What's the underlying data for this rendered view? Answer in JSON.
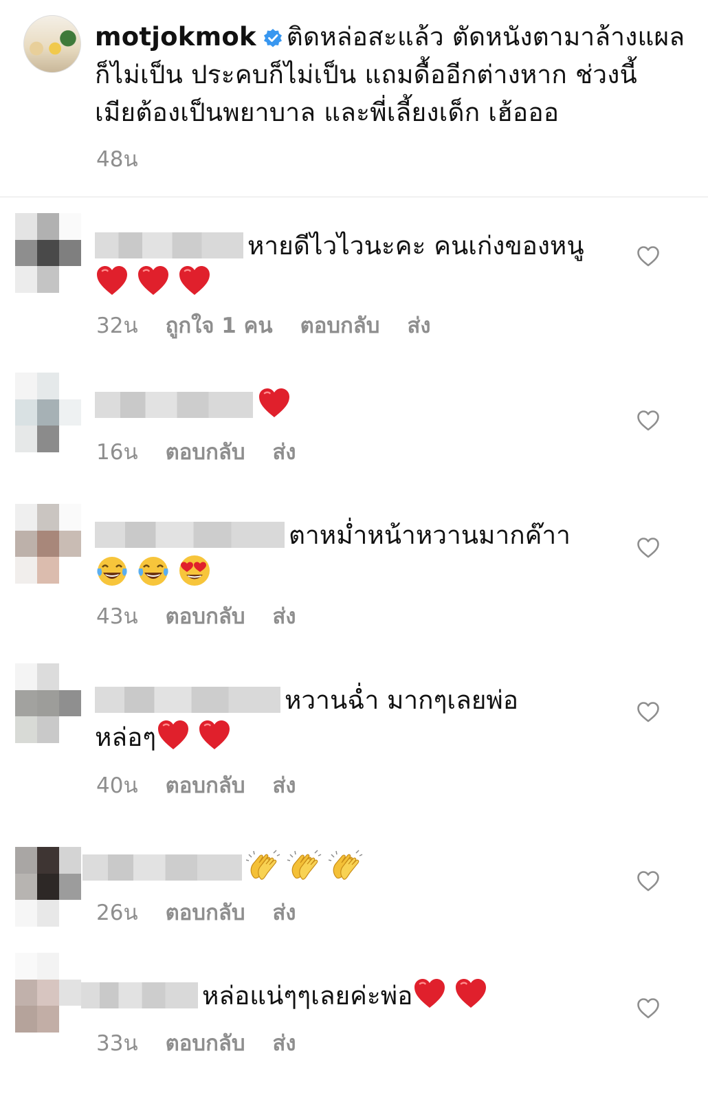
{
  "post": {
    "username": "motjokmok",
    "caption": "ติดหล่อสะแล้ว  ตัดหนังตามาล้างแผลก็ไม่เป็น ประคบก็ไม่เป็น  แถมดื้ออีกต่างหาก ช่วงนี้ เมียต้องเป็นพยาบาล และพี่เลี้ยงเด็ก เฮ้อออ",
    "time": "48น"
  },
  "comments": [
    {
      "text": "หายดีไวไวนะคะ คนเก่งของหนู",
      "emojis": [
        "red-heart",
        "red-heart",
        "red-heart"
      ],
      "time": "32น",
      "likes": "ถูกใจ 1 คน",
      "reply": "ตอบกลับ",
      "send": "ส่ง"
    },
    {
      "text": "",
      "emojis": [
        "red-heart"
      ],
      "time": "16น",
      "reply": "ตอบกลับ",
      "send": "ส่ง"
    },
    {
      "text": "ตาหม่ำหน้าหวานมากค๊าา",
      "emojis": [
        "tears-of-joy",
        "tears-of-joy",
        "heart-eyes"
      ],
      "time": "43น",
      "reply": "ตอบกลับ",
      "send": "ส่ง"
    },
    {
      "text": "หวานฉ่ำ มากๆเลยพ่อ",
      "text2": "หล่อๆ",
      "emojis": [
        "red-heart",
        "red-heart"
      ],
      "time": "40น",
      "reply": "ตอบกลับ",
      "send": "ส่ง"
    },
    {
      "text": "",
      "emojis": [
        "clapping-hands",
        "clapping-hands",
        "clapping-hands"
      ],
      "time": "26น",
      "reply": "ตอบกลับ",
      "send": "ส่ง"
    },
    {
      "text": "หล่อแน่ๆๆเลยค่ะพ่อ",
      "emojis": [
        "red-heart",
        "red-heart"
      ],
      "time": "33น",
      "reply": "ตอบกลับ",
      "send": "ส่ง"
    }
  ],
  "colors": {
    "meta_gray": "#8e8e8e",
    "verified_blue": "#3897f0",
    "heart_red": "#e0202c"
  }
}
